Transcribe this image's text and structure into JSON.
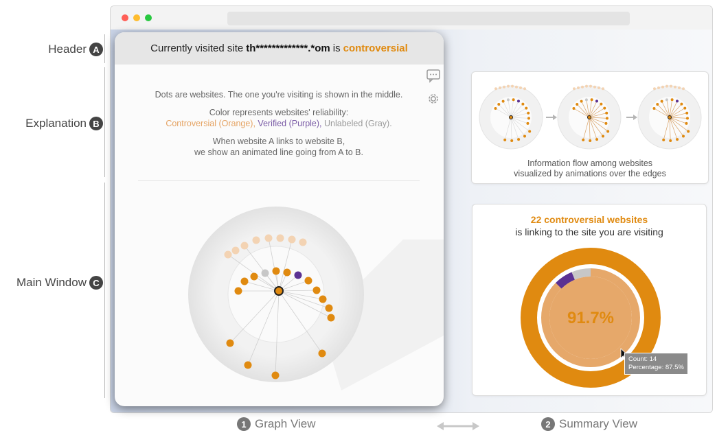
{
  "side_labels": {
    "header": {
      "text": "Header",
      "badge": "A"
    },
    "explanation": {
      "text": "Explanation",
      "badge": "B"
    },
    "main_window": {
      "text": "Main Window",
      "badge": "C"
    }
  },
  "colors": {
    "orange": "#e08a10",
    "light_orange": "#e6a86a",
    "pale_orange": "#f3d3b3",
    "purple": "#5b3192",
    "gray": "#c7c7c7"
  },
  "graph_view": {
    "header": {
      "prefix": "Currently visited site",
      "site": "th*************.*om",
      "mid": "is",
      "status": "controversial"
    },
    "explanation": {
      "line1": "Dots are websites. The one you're visiting is shown in the middle.",
      "line2": "Color represents websites' reliability:",
      "legend_controversial": "Controversial (Orange),",
      "legend_verified": "Verified (Purple),",
      "legend_unlabeled": "Unlabeled (Gray).",
      "line4": "When website A links to website B,",
      "line5": "we show an animated line going from A to B."
    },
    "icons": [
      "comment-icon",
      "gear-icon"
    ]
  },
  "flow_card": {
    "caption_line1": "Information flow among websites",
    "caption_line2": "visualized by animations over the edges"
  },
  "summary": {
    "title": "22 controversial websites",
    "subtitle": "is linking to the site you are visiting",
    "percentage": "91.7%",
    "outer_ring": {
      "orange_fraction": 1.0
    },
    "inner_ring": {
      "light_orange_fraction": 0.875,
      "purple_fraction": 0.0625,
      "gray_fraction": 0.0625
    },
    "tooltip": {
      "count": "Count: 14",
      "percentage": "Percentage: 87.5%"
    }
  },
  "footer": {
    "graph_view": {
      "badge": "1",
      "label": "Graph View"
    },
    "summary_view": {
      "badge": "2",
      "label": "Summary View"
    }
  }
}
